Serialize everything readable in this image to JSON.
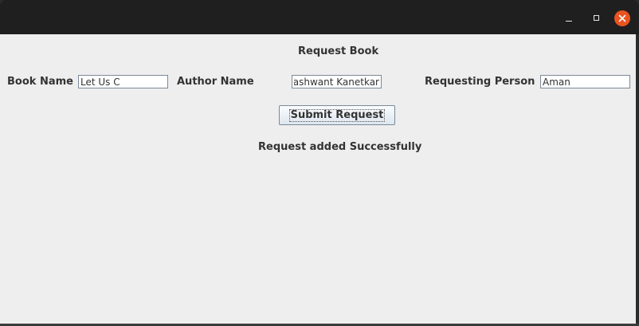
{
  "window": {
    "controls": {
      "minimize_icon": "minimize-icon",
      "maximize_icon": "maximize-icon",
      "close_icon": "close-icon",
      "close_color": "#e95420"
    }
  },
  "form": {
    "heading": "Request Book",
    "book_name_label": "Book Name",
    "book_name_value": "Let Us C",
    "author_name_label": "Author Name",
    "author_name_value": "Yashwant Kanetkar",
    "requesting_person_label": "Requesting Person",
    "requesting_person_value": "Aman",
    "submit_label": "Submit Request",
    "status_message": "Request added Successfully"
  }
}
